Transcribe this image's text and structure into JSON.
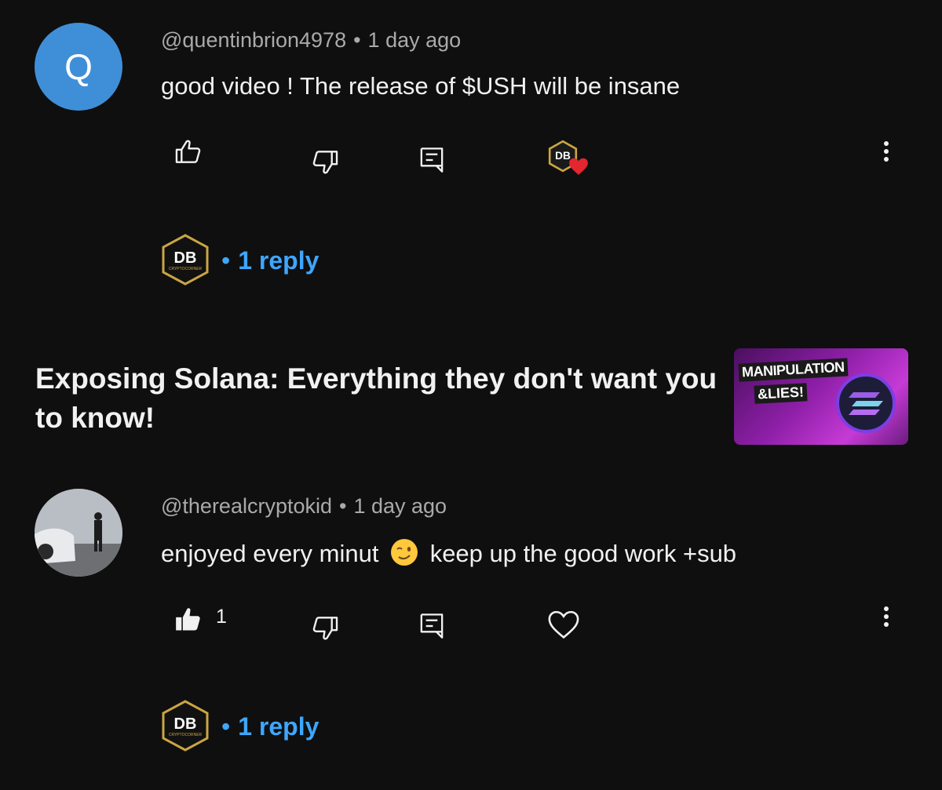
{
  "comments": [
    {
      "avatar_letter": "Q",
      "avatar_color": "#3f8fd8",
      "author": "@quentinbrion4978",
      "separator": "•",
      "time": "1 day ago",
      "text": "good video ! The release of $USH will be insane",
      "like_count": "",
      "liked": false,
      "creator_hearted": true,
      "replies": "1 reply"
    },
    {
      "author": "@therealcryptokid",
      "separator": "•",
      "time": "1 day ago",
      "text_before_emoji": "enjoyed every minut",
      "text_after_emoji": "keep up the good work +sub",
      "like_count": "1",
      "liked": true,
      "creator_hearted": false,
      "replies": "1 reply"
    }
  ],
  "video": {
    "title": "Exposing Solana: Everything they don't want you to know!",
    "thumbnail_text_1": "MANIPULATION",
    "thumbnail_text_2": "&LIES!"
  },
  "creator_logo_text": "DB",
  "creator_logo_subtext": "CRYPTOCORNER",
  "colors": {
    "background": "#0f0f0f",
    "link": "#3ea6ff",
    "heart": "#e3262f",
    "gold": "#c9a544"
  }
}
